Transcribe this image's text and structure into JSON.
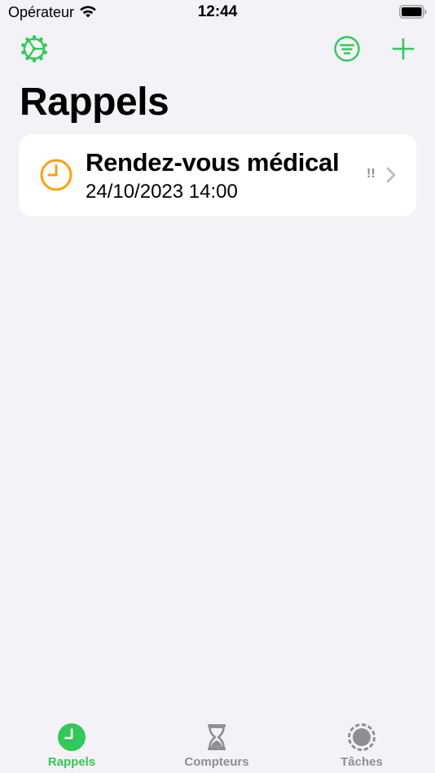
{
  "status_bar": {
    "carrier": "Opérateur",
    "time": "12:44"
  },
  "nav": {
    "title": "Rappels",
    "left_icon": "settings-gear-icon",
    "right_icons": [
      "filter-icon",
      "plus-icon"
    ]
  },
  "reminders": [
    {
      "title": "Rendez-vous médical",
      "datetime": "24/10/2023 14:00",
      "priority": "!!",
      "icon": "clock-icon"
    }
  ],
  "tabs": [
    {
      "label": "Rappels",
      "icon": "clock-icon",
      "selected": true
    },
    {
      "label": "Compteurs",
      "icon": "hourglass-icon",
      "selected": false
    },
    {
      "label": "Tâches",
      "icon": "circle-dashed-icon",
      "selected": false
    }
  ],
  "colors": {
    "accent": "#34c759",
    "clock_orange": "#ff9f0a",
    "inactive_gray": "#8e8e93",
    "background": "#f2f2f7",
    "card": "#ffffff"
  }
}
